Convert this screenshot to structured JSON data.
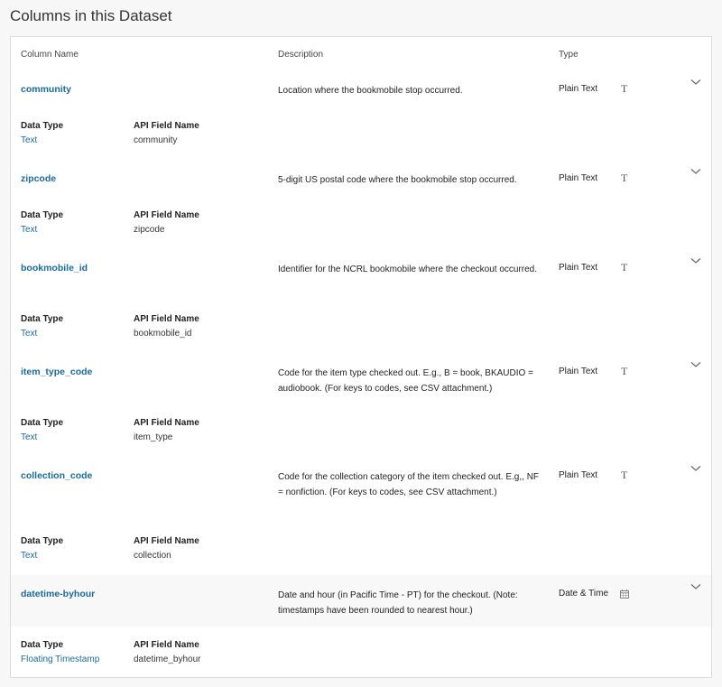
{
  "heading": "Columns in this Dataset",
  "table_headers": {
    "column_name": "Column Name",
    "description": "Description",
    "type": "Type"
  },
  "detail_labels": {
    "data_type": "Data Type",
    "api_field_name": "API Field Name"
  },
  "columns": [
    {
      "name": "community",
      "description": "Location where the bookmobile stop occurred.",
      "type": "Plain Text",
      "type_icon": "text-type-icon",
      "data_type": "Text",
      "api_field_name": "community"
    },
    {
      "name": "zipcode",
      "description": "5-digit US postal code where the bookmobile stop occurred.",
      "type": "Plain Text",
      "type_icon": "text-type-icon",
      "data_type": "Text",
      "api_field_name": "zipcode"
    },
    {
      "name": "bookmobile_id",
      "description": "Identifier for the NCRL bookmobile where the checkout occurred.",
      "type": "Plain Text",
      "type_icon": "text-type-icon",
      "data_type": "Text",
      "api_field_name": "bookmobile_id"
    },
    {
      "name": "item_type_code",
      "description": "Code for the item type checked out. E.g., B = book, BKAUDIO = audiobook. (For keys to codes, see CSV attachment.)",
      "type": "Plain Text",
      "type_icon": "text-type-icon",
      "data_type": "Text",
      "api_field_name": "item_type"
    },
    {
      "name": "collection_code",
      "description": "Code for the collection category of the item checked out. E.g,, NF = nonfiction. (For keys to codes, see CSV attachment.)",
      "type": "Plain Text",
      "type_icon": "text-type-icon",
      "data_type": "Text",
      "api_field_name": "collection"
    },
    {
      "name": "datetime-byhour",
      "description": "Date and hour (in Pacific Time - PT) for the checkout. (Note: timestamps have been rounded to nearest hour.)",
      "type": "Date & Time",
      "type_icon": "calendar-icon",
      "data_type": "Floating Timestamp",
      "api_field_name": "datetime_byhour"
    }
  ],
  "colors": {
    "link": "#1b6a9e",
    "border": "#e6e6e6",
    "highlight_row": "#f8f8f8"
  }
}
